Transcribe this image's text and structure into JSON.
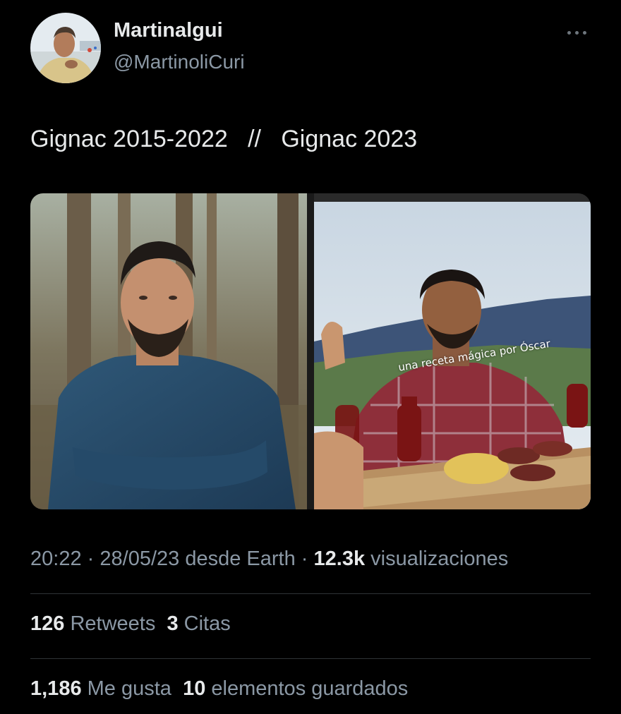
{
  "author": {
    "display_name": "Martinalgui",
    "handle": "@MartinoliCuri",
    "avatar_icon": "profile-photo"
  },
  "more_icon": "ellipsis-icon",
  "tweet": {
    "text": "Gignac 2015-2022   //   Gignac 2023"
  },
  "media": {
    "left_photo": "man-with-beard-in-forest",
    "right_photo": "man-at-barbecue-table",
    "right_caption": "una receta mágica por Óscar"
  },
  "meta": {
    "time": "20:22",
    "date": "28/05/23",
    "source": "desde Earth",
    "separator": "·",
    "views_count": "12.3k",
    "views_label": "visualizaciones"
  },
  "engagement": {
    "retweets_count": "126",
    "retweets_label": "Retweets",
    "quotes_count": "3",
    "quotes_label": "Citas",
    "likes_count": "1,186",
    "likes_label": "Me gusta",
    "bookmarks_count": "10",
    "bookmarks_label": "elementos guardados"
  },
  "colors": {
    "background": "#000000",
    "primary_text": "#e7e9ea",
    "secondary_text": "#8b98a5",
    "divider": "#2f3336"
  }
}
